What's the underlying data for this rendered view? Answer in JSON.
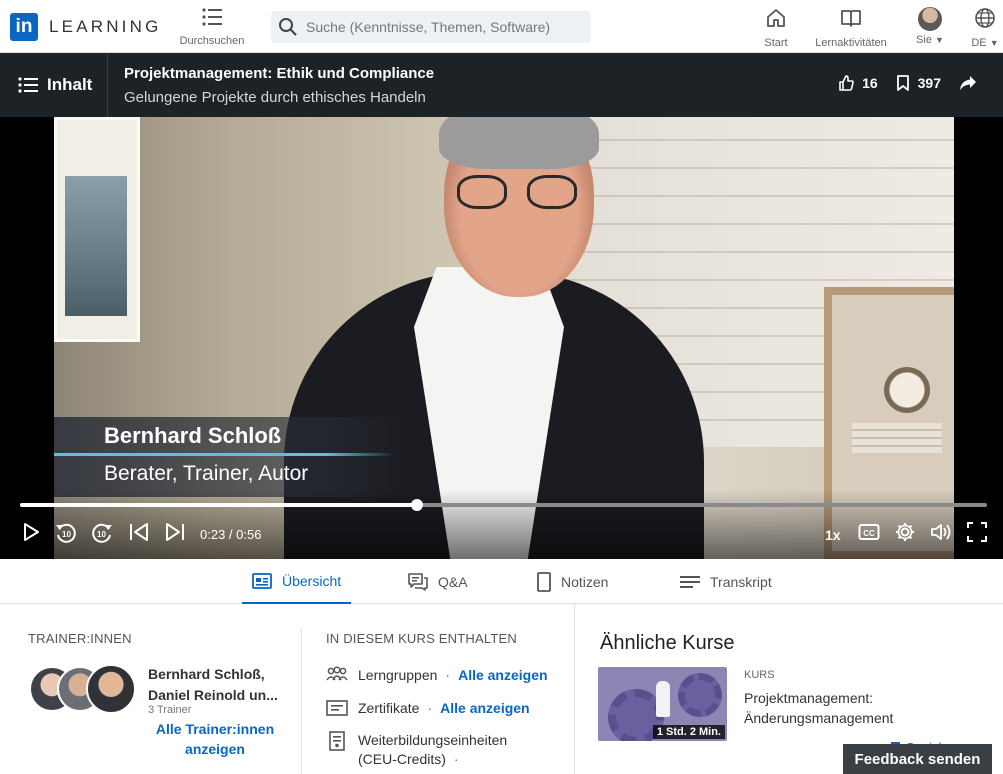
{
  "nav": {
    "logo_letters": "in",
    "logo_word": "LEARNING",
    "browse_label": "Durchsuchen",
    "search_placeholder": "Suche (Kenntnisse, Themen, Software)",
    "items": [
      {
        "label": "Start",
        "icon": "home-icon"
      },
      {
        "label": "Lernaktivitäten",
        "icon": "book-icon"
      },
      {
        "label": "Sie",
        "icon": "avatar"
      },
      {
        "label": "DE",
        "icon": "globe-icon"
      }
    ]
  },
  "course": {
    "contents_label": "Inhalt",
    "title": "Projektmanagement: Ethik und Compliance",
    "subtitle": "Gelungene Projekte durch ethisches Handeln",
    "likes": "16",
    "saves": "397"
  },
  "video": {
    "speaker_name": "Bernhard Schloß",
    "speaker_role": "Berater, Trainer, Autor",
    "time_display": "0:23 / 0:56",
    "progress_fraction": 0.4107,
    "speed": "1x",
    "skip_back_seconds": "10",
    "skip_forward_seconds": "10"
  },
  "tabs": [
    {
      "label": "Übersicht",
      "icon": "overview-icon",
      "active": true
    },
    {
      "label": "Q&A",
      "icon": "qa-icon",
      "active": false
    },
    {
      "label": "Notizen",
      "icon": "notes-icon",
      "active": false
    },
    {
      "label": "Transkript",
      "icon": "transcript-icon",
      "active": false
    }
  ],
  "trainers": {
    "heading": "TRAINER:INNEN",
    "names": "Bernhard Schloß, Daniel Reinold un...",
    "count": "3 Trainer",
    "all_link": "Alle Trainer:innen anzeigen"
  },
  "included": {
    "heading": "IN DIESEM KURS ENTHALTEN",
    "items": [
      {
        "label": "Lerngruppen",
        "link": "Alle anzeigen",
        "icon": "groups-icon"
      },
      {
        "label": "Zertifikate",
        "link": "Alle anzeigen",
        "icon": "certificate-icon"
      },
      {
        "label": "Weiterbildungseinheiten (CEU-Credits)",
        "link": "",
        "icon": "ceu-icon"
      }
    ]
  },
  "similar": {
    "heading": "Ähnliche Kurse",
    "type": "KURS",
    "course_title": "Projektmanagement: Änderungsmanagement",
    "duration": "1 Std. 2 Min.",
    "save_label": "Speichern"
  },
  "feedback_label": "Feedback senden",
  "colors": {
    "brand": "#0a66c2",
    "course_bar": "#1d2226",
    "feedback_bg": "#3a3f44"
  }
}
